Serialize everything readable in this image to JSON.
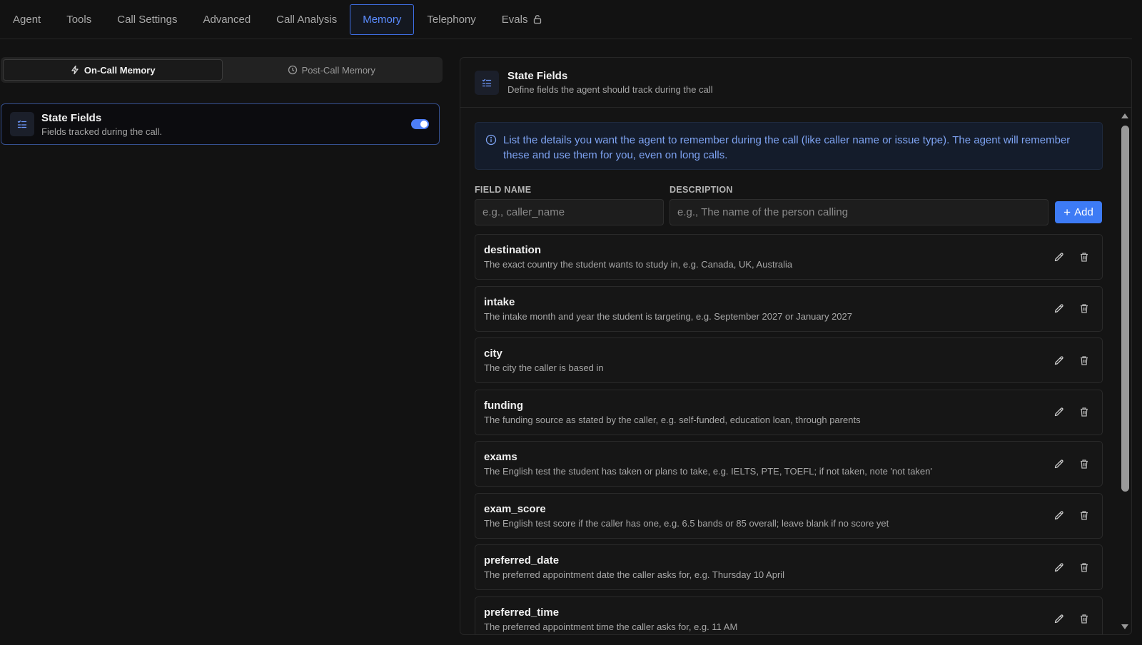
{
  "tabs": [
    {
      "label": "Agent",
      "active": false
    },
    {
      "label": "Tools",
      "active": false
    },
    {
      "label": "Call Settings",
      "active": false
    },
    {
      "label": "Advanced",
      "active": false
    },
    {
      "label": "Call Analysis",
      "active": false
    },
    {
      "label": "Memory",
      "active": true
    },
    {
      "label": "Telephony",
      "active": false
    },
    {
      "label": "Evals",
      "active": false,
      "icon": "lock-icon"
    }
  ],
  "memory_modes": {
    "on_call": {
      "label": "On-Call Memory",
      "icon": "lightning-icon",
      "active": true
    },
    "post_call": {
      "label": "Post-Call Memory",
      "icon": "clock-icon",
      "active": false
    }
  },
  "state_card": {
    "title": "State Fields",
    "subtitle": "Fields tracked during the call.",
    "enabled": true
  },
  "panel": {
    "title": "State Fields",
    "subtitle": "Define fields the agent should track during the call",
    "info": "List the details you want the agent to remember during the call (like caller name or issue type). The agent will remember these and use them for you, even on long calls."
  },
  "form": {
    "field_name_label": "FIELD NAME",
    "description_label": "DESCRIPTION",
    "field_name_placeholder": "e.g., caller_name",
    "description_placeholder": "e.g., The name of the person calling",
    "add_label": "Add"
  },
  "fields": [
    {
      "name": "destination",
      "description": "The exact country the student wants to study in, e.g. Canada, UK, Australia"
    },
    {
      "name": "intake",
      "description": "The intake month and year the student is targeting, e.g. September 2027 or January 2027"
    },
    {
      "name": "city",
      "description": "The city the caller is based in"
    },
    {
      "name": "funding",
      "description": "The funding source as stated by the caller, e.g. self-funded, education loan, through parents"
    },
    {
      "name": "exams",
      "description": "The English test the student has taken or plans to take, e.g. IELTS, PTE, TOEFL; if not taken, note 'not taken'"
    },
    {
      "name": "exam_score",
      "description": "The English test score if the caller has one, e.g. 6.5 bands or 85 overall; leave blank if no score yet"
    },
    {
      "name": "preferred_date",
      "description": "The preferred appointment date the caller asks for, e.g. Thursday 10 April"
    },
    {
      "name": "preferred_time",
      "description": "The preferred appointment time the caller asks for, e.g. 11 AM"
    }
  ],
  "colors": {
    "accent": "#3d7bf5",
    "active_tab": "#5b8cff",
    "info_text": "#7ea3f2",
    "background": "#121212"
  }
}
